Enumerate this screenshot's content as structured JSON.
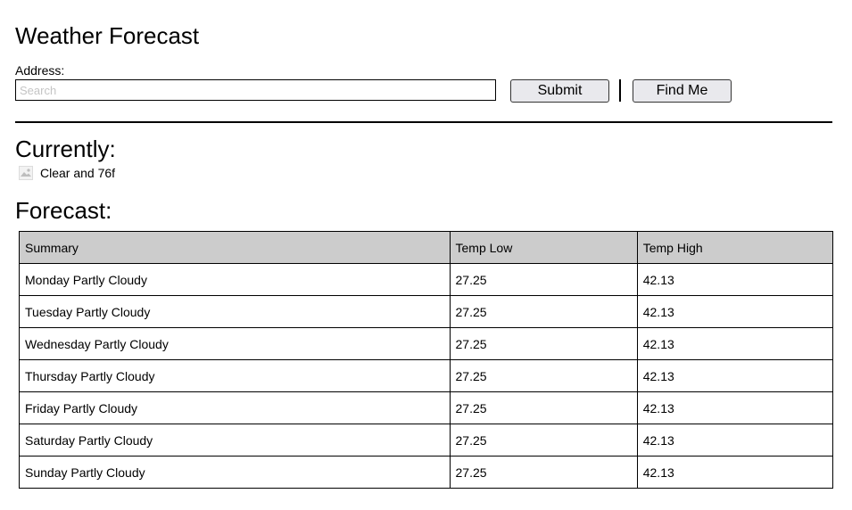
{
  "header": {
    "title": "Weather Forecast"
  },
  "search": {
    "label": "Address:",
    "placeholder": "Search",
    "value": "",
    "submit_label": "Submit",
    "find_me_label": "Find Me"
  },
  "current": {
    "heading": "Currently:",
    "icon": "broken-image-icon",
    "text": "Clear and 76f"
  },
  "forecast": {
    "heading": "Forecast:",
    "columns": [
      "Summary",
      "Temp Low",
      "Temp High"
    ],
    "rows": [
      [
        "Monday Partly Cloudy",
        "27.25",
        "42.13"
      ],
      [
        "Tuesday Partly Cloudy",
        "27.25",
        "42.13"
      ],
      [
        "Wednesday Partly Cloudy",
        "27.25",
        "42.13"
      ],
      [
        "Thursday Partly Cloudy",
        "27.25",
        "42.13"
      ],
      [
        "Friday Partly Cloudy",
        "27.25",
        "42.13"
      ],
      [
        "Saturday Partly Cloudy",
        "27.25",
        "42.13"
      ],
      [
        "Sunday Partly Cloudy",
        "27.25",
        "42.13"
      ]
    ]
  },
  "colors": {
    "header_row_bg": "#cccccc",
    "button_bg": "#e9e9ed",
    "border": "#000000",
    "placeholder": "#c4c4c4"
  }
}
